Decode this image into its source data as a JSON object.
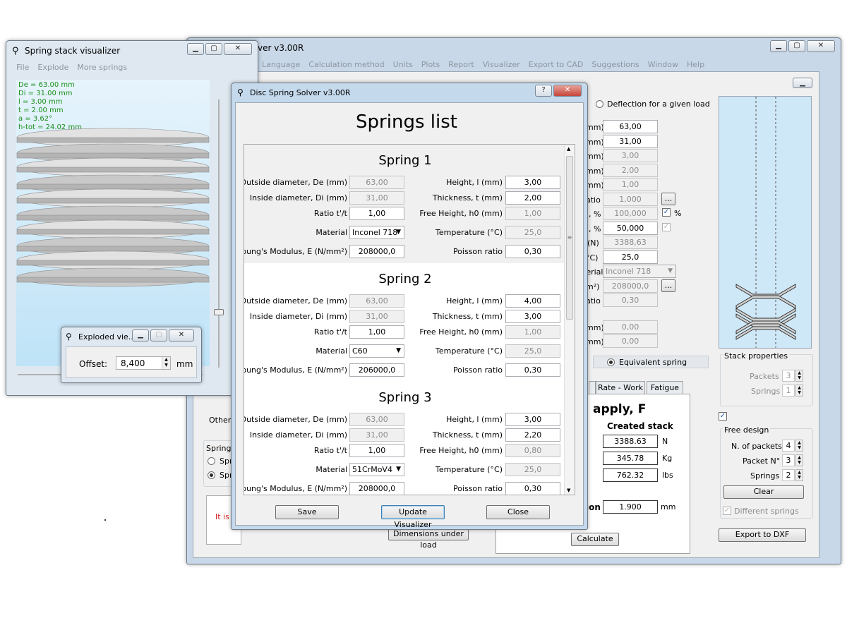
{
  "main_window": {
    "title_fragment": "ver v3.00R",
    "menu": [
      "Language",
      "Calculation method",
      "Units",
      "Plots",
      "Report",
      "Visualizer",
      "Export to CAD",
      "Suggestions",
      "Window",
      "Help"
    ],
    "radio_deflection": "Deflection for a given load",
    "fields": [
      "63,00",
      "31,00",
      "3,00",
      "2,00",
      "1,00",
      "1,000",
      "100,000",
      "50,000",
      "3388,63",
      "25,0",
      "208000,0",
      "0,30",
      "0,00",
      "0,00"
    ],
    "label_fragments": [
      "mm)",
      "mm)",
      "mm)",
      "mm)",
      "mm)",
      "atio",
      ", %",
      ", %",
      "(N)",
      "°C)",
      "terial",
      "m²)",
      "atio",
      "mm)",
      "mm)"
    ],
    "percent_sign": "%",
    "ellipsis": "...",
    "material_combo": "Inconel 718",
    "equivalent_spring": "Equivalent spring",
    "tabs": [
      "Rate - Work",
      "Fatigue"
    ],
    "load_heading": "apply, F",
    "created_stack": "Created stack",
    "results": [
      {
        "value": "3388.63",
        "unit": "N"
      },
      {
        "value": "345.78",
        "unit": "Kg"
      },
      {
        "value": "762.32",
        "unit": "lbs"
      }
    ],
    "deflection_label": "ion",
    "deflection_value": "1.900",
    "deflection_unit": "mm",
    "calculate": "Calculate",
    "dimensions_under_load": "Dimensions under load",
    "other_fragment": "Other t",
    "spring_type_fragment": "Spring t",
    "spring_type_opts": [
      "Spri",
      "Spri"
    ],
    "warn_fragment": "It is n",
    "stack_properties": {
      "title": "Stack properties",
      "packets_label": "Packets",
      "packets": "3",
      "springs_label": "Springs",
      "springs": "1"
    },
    "free_design": {
      "title": "Free design",
      "packets_label": "N. of packets",
      "packets": "4",
      "packet_no_label": "Packet N°",
      "packet_no": "3",
      "springs_label": "Springs",
      "springs": "2",
      "clear": "Clear",
      "different": "Different springs"
    },
    "export_dxf": "Export to DXF",
    "colors": {
      "sky": "#cfe8f8",
      "accent": "#1b4fa8"
    }
  },
  "visualizer": {
    "title": "Spring stack visualizer",
    "menu": [
      "File",
      "Explode",
      "More springs"
    ],
    "info": [
      "De = 63.00 mm",
      "Di = 31.00 mm",
      "l = 3.00 mm",
      "t = 2.00 mm",
      "a = 3.62°",
      "h-tot = 24.02 mm"
    ],
    "info_color": "#1c8f1c"
  },
  "exploded": {
    "title": "Exploded vie...",
    "offset_label": "Offset:",
    "offset_value": "8,400",
    "unit": "mm"
  },
  "dialog": {
    "title": "Disc Spring Solver v3.00R",
    "heading": "Springs list",
    "labels_left": [
      "Outside diameter, De (mm)",
      "Inside diameter, Di (mm)",
      "Ratio t'/t",
      "Material",
      "oung's Modulus, E (N/mm²)"
    ],
    "labels_right": [
      "Height, l (mm)",
      "Thickness, t (mm)",
      "Free Height, h0 (mm)",
      "Temperature (°C)",
      "Poisson ratio"
    ],
    "springs": [
      {
        "name": "Spring 1",
        "de": "63,00",
        "di": "31,00",
        "ratio": "1,00",
        "material": "Inconel 718",
        "e": "208000,0",
        "l": "3,00",
        "t": "2,00",
        "h0": "1,00",
        "temp": "25,0",
        "poisson": "0,30"
      },
      {
        "name": "Spring 2",
        "de": "63,00",
        "di": "31,00",
        "ratio": "1,00",
        "material": "C60",
        "e": "206000,0",
        "l": "4,00",
        "t": "3,00",
        "h0": "1,00",
        "temp": "25,0",
        "poisson": "0,30"
      },
      {
        "name": "Spring 3",
        "de": "63,00",
        "di": "31,00",
        "ratio": "1,00",
        "material": "51CrMoV4",
        "e": "208000,0",
        "l": "3,00",
        "t": "2,20",
        "h0": "0,80",
        "temp": "25,0",
        "poisson": "0,30"
      }
    ],
    "save": "Save",
    "update": "Update Visualizer",
    "close": "Close"
  }
}
